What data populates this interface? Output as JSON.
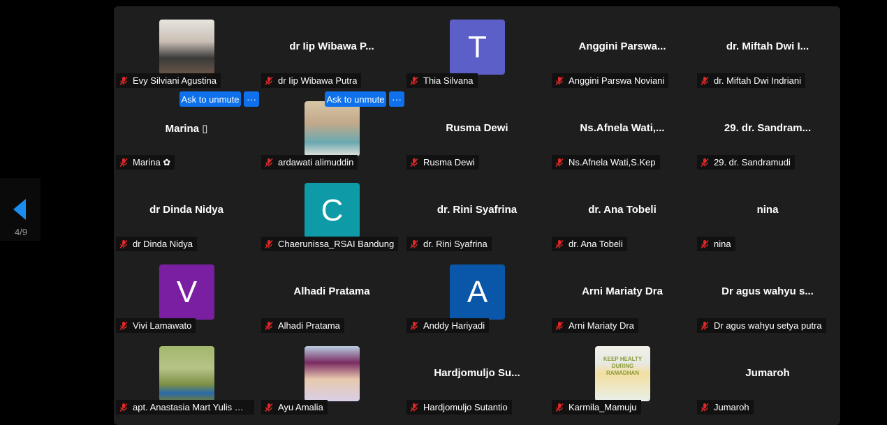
{
  "nav": {
    "page_indicator": "4/9",
    "colors": {
      "arrow": "#1a8cf0"
    }
  },
  "controls": {
    "ask_to_unmute": "Ask to unmute",
    "more": "···"
  },
  "tiles": [
    {
      "display": "",
      "name": "Evy Silviani Agustina",
      "avatar": "photo-evy"
    },
    {
      "display": "dr Iip Wibawa P...",
      "name": "dr Iip Wibawa Putra"
    },
    {
      "display": "",
      "name": "Thia Silvana",
      "letter": "T",
      "color": "#5b5fc7"
    },
    {
      "display": "Anggini Parswa...",
      "name": "Anggini Parswa Noviani"
    },
    {
      "display": "dr. Miftah Dwi I...",
      "name": "dr. Miftah Dwi Indriani"
    },
    {
      "display": "Marina ▯",
      "name": "Marina ✿"
    },
    {
      "display": "",
      "name": "ardawati alimuddin",
      "avatar": "photo-ardawati"
    },
    {
      "display": "Rusma Dewi",
      "name": "Rusma Dewi"
    },
    {
      "display": "Ns.Afnela Wati,...",
      "name": "Ns.Afnela Wati,S.Kep"
    },
    {
      "display": "29. dr. Sandram...",
      "name": "29. dr. Sandramudi"
    },
    {
      "display": "dr Dinda Nidya",
      "name": "dr Dinda Nidya"
    },
    {
      "display": "",
      "name": "Chaerunissa_RSAI Bandung",
      "letter": "C",
      "color": "#0e9aa7"
    },
    {
      "display": "dr. Rini Syafrina",
      "name": "dr. Rini Syafrina"
    },
    {
      "display": "dr. Ana Tobeli",
      "name": "dr. Ana Tobeli"
    },
    {
      "display": "nina",
      "name": "nina"
    },
    {
      "display": "",
      "name": "Vivi Lamawato",
      "letter": "V",
      "color": "#7b1fa2"
    },
    {
      "display": "Alhadi Pratama",
      "name": "Alhadi Pratama"
    },
    {
      "display": "",
      "name": "Anddy Hariyadi",
      "letter": "A",
      "color": "#0a56a8"
    },
    {
      "display": "Arni Mariaty Dra",
      "name": "Arni Mariaty Dra"
    },
    {
      "display": "Dr agus wahyu s...",
      "name": "Dr agus wahyu setya putra"
    },
    {
      "display": "",
      "name": "apt. Anastasia Mart Yulis Her...",
      "avatar": "photo-anastasia"
    },
    {
      "display": "",
      "name": "Ayu Amalia",
      "avatar": "photo-ayu"
    },
    {
      "display": "Hardjomuljo Su...",
      "name": "Hardjomuljo Sutantio"
    },
    {
      "display": "",
      "name": "Karmila_Mamuju",
      "avatar": "photo-karmila",
      "poster_text": "KEEP HEALTY DURING RAMADHAN"
    },
    {
      "display": "Jumaroh",
      "name": "Jumaroh"
    }
  ]
}
